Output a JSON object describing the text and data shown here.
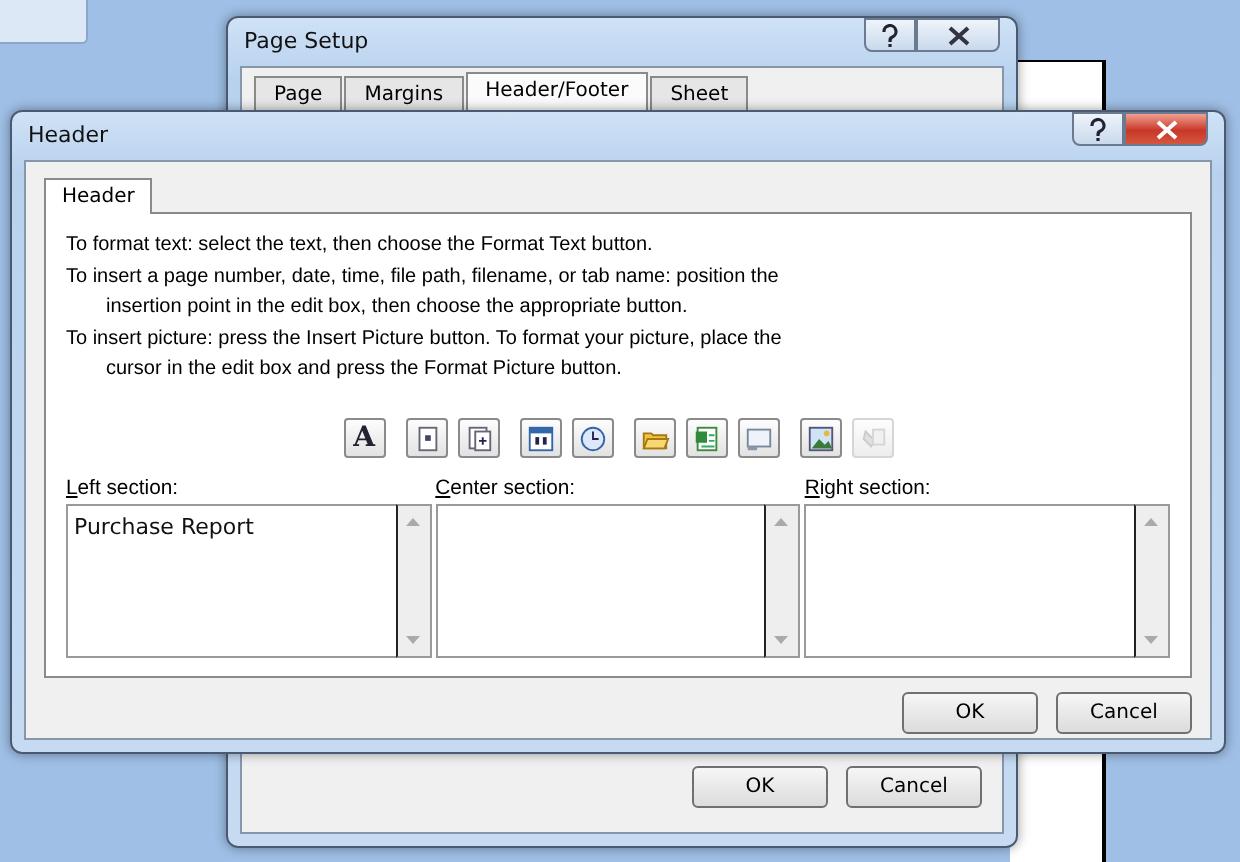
{
  "page_setup": {
    "title": "Page Setup",
    "tabs": [
      {
        "label": "Page",
        "selected": false
      },
      {
        "label": "Margins",
        "selected": false
      },
      {
        "label": "Header/Footer",
        "selected": true
      },
      {
        "label": "Sheet",
        "selected": false
      }
    ],
    "buttons": [
      "OK",
      "Cancel"
    ]
  },
  "header_dialog": {
    "title": "Header",
    "tabs": [
      {
        "label": "Header",
        "selected": true
      }
    ],
    "instructions": [
      "To format text:  select the text, then choose the Format Text button.",
      "To insert a page number, date, time, file path, filename, or tab name:  position the insertion point in the edit box, then choose the appropriate button.",
      "To insert picture: press the Insert Picture button.  To format your picture, place the cursor in the edit box and press the Format Picture button."
    ],
    "toolbar_groups": [
      [
        {
          "kind": "format_text",
          "label": "A",
          "disabled": false
        }
      ],
      [
        {
          "kind": "page_number",
          "disabled": false
        },
        {
          "kind": "page_count",
          "disabled": false
        }
      ],
      [
        {
          "kind": "date",
          "disabled": false
        },
        {
          "kind": "time",
          "disabled": false
        }
      ],
      [
        {
          "kind": "file_path",
          "disabled": false
        },
        {
          "kind": "filename",
          "disabled": false
        },
        {
          "kind": "sheet_name",
          "disabled": false
        }
      ],
      [
        {
          "kind": "insert_picture",
          "disabled": false
        },
        {
          "kind": "format_picture",
          "disabled": true
        }
      ]
    ],
    "sections": [
      {
        "label": "Left section:",
        "value": "Purchase Report"
      },
      {
        "label": "Center section:"
      },
      {
        "label": "Right section:"
      }
    ],
    "buttons": [
      "OK",
      "Cancel"
    ]
  }
}
